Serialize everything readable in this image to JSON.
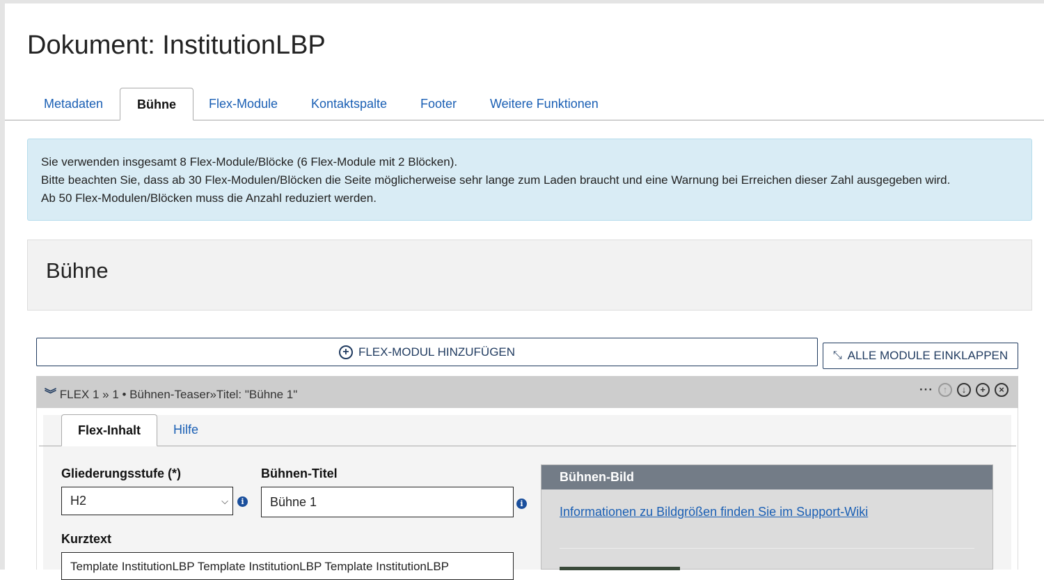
{
  "page_title": "Dokument: InstitutionLBP",
  "tabs": [
    "Metadaten",
    "Bühne",
    "Flex-Module",
    "Kontaktspalte",
    "Footer",
    "Weitere Funktionen"
  ],
  "active_tab": "Bühne",
  "info_lines": [
    "Sie verwenden insgesamt 8 Flex-Module/Blöcke (6 Flex-Module mit 2 Blöcken).",
    "Bitte beachten Sie, dass ab 30 Flex-Modulen/Blöcken die Seite möglicherweise sehr lange zum Laden braucht und eine Warnung bei Erreichen dieser Zahl ausgegeben wird.",
    "Ab 50 Flex-Modulen/Blöcken muss die Anzahl reduziert werden."
  ],
  "section_title": "Bühne",
  "add_button": "FLEX-MODUL HINZUFÜGEN",
  "collapse_button": "ALLE MODULE EINKLAPPEN",
  "flex": {
    "header": "FLEX 1 »  1 • Bühnen-Teaser»Titel: \"Bühne 1\"",
    "tabs": [
      "Flex-Inhalt",
      "Hilfe"
    ],
    "gliederung_label": "Gliederungsstufe (*)",
    "gliederung_value": "H2",
    "titel_label": "Bühnen-Titel",
    "titel_value": "Bühne 1",
    "kurztext_label": "Kurztext",
    "kurztext_value": "Template InstitutionLBP Template InstitutionLBP Template InstitutionLBP",
    "bild_header": "Bühnen-Bild",
    "bild_link": "Informationen zu Bildgrößen finden Sie im Support-Wiki"
  }
}
